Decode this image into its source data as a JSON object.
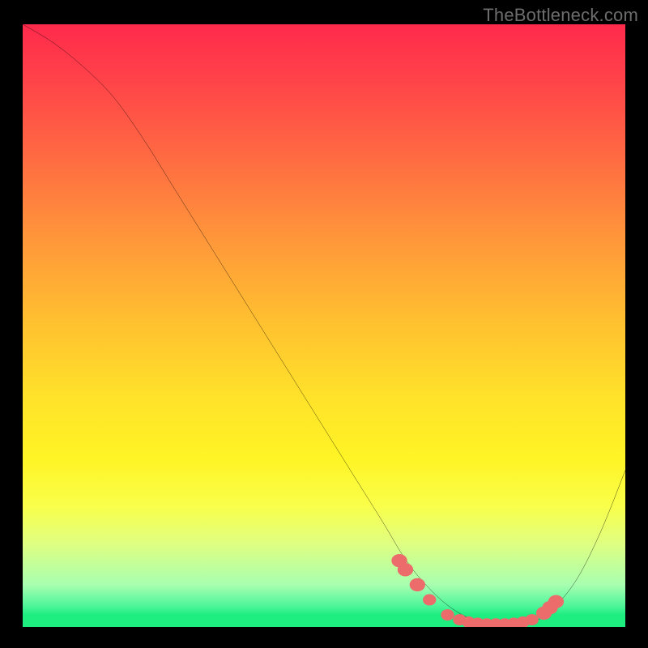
{
  "watermark": "TheBottleneck.com",
  "colors": {
    "page_bg": "#000000",
    "watermark_text": "#6d6d6d",
    "curve_stroke": "#000000",
    "marker_fill": "#ec6b6b",
    "gradient_stops": [
      "#ff2a4b",
      "#ff3f4a",
      "#ff6a42",
      "#ff983a",
      "#ffc22f",
      "#ffe22a",
      "#fff425",
      "#f9ff4a",
      "#e0ff80",
      "#a8ffb0",
      "#4ef59a",
      "#1eed80"
    ]
  },
  "chart_data": {
    "type": "line",
    "title": "",
    "xlabel": "",
    "ylabel": "",
    "xlim": [
      0,
      100
    ],
    "ylim": [
      0,
      100
    ],
    "grid": false,
    "legend_position": "none",
    "series": [
      {
        "name": "curve",
        "x": [
          0,
          5,
          10,
          15,
          20,
          25,
          30,
          35,
          40,
          45,
          50,
          55,
          60,
          63,
          66,
          70,
          74,
          78,
          82,
          85,
          88,
          92,
          96,
          100
        ],
        "y": [
          100,
          97,
          93,
          88,
          81,
          73,
          65,
          57,
          49,
          41,
          33,
          25,
          17,
          12,
          8,
          4,
          1.5,
          0.5,
          0.5,
          1,
          3,
          8,
          16,
          26
        ]
      }
    ],
    "markers": [
      {
        "x": 62.5,
        "y": 11,
        "r": 1.3
      },
      {
        "x": 63.5,
        "y": 9.5,
        "r": 1.3
      },
      {
        "x": 65.5,
        "y": 7,
        "r": 1.3
      },
      {
        "x": 67.5,
        "y": 4.5,
        "r": 1.1
      },
      {
        "x": 70.5,
        "y": 2,
        "r": 1.1
      },
      {
        "x": 72.5,
        "y": 1.2,
        "r": 1.1
      },
      {
        "x": 74,
        "y": 0.8,
        "r": 1.1
      },
      {
        "x": 75.5,
        "y": 0.6,
        "r": 1.1
      },
      {
        "x": 77,
        "y": 0.5,
        "r": 1.1
      },
      {
        "x": 78.5,
        "y": 0.5,
        "r": 1.1
      },
      {
        "x": 80,
        "y": 0.5,
        "r": 1.1
      },
      {
        "x": 81.5,
        "y": 0.6,
        "r": 1.1
      },
      {
        "x": 83,
        "y": 0.8,
        "r": 1.1
      },
      {
        "x": 84.5,
        "y": 1.2,
        "r": 1.1
      },
      {
        "x": 86.5,
        "y": 2.3,
        "r": 1.3
      },
      {
        "x": 87.5,
        "y": 3.2,
        "r": 1.3
      },
      {
        "x": 88.5,
        "y": 4.2,
        "r": 1.3
      }
    ]
  }
}
